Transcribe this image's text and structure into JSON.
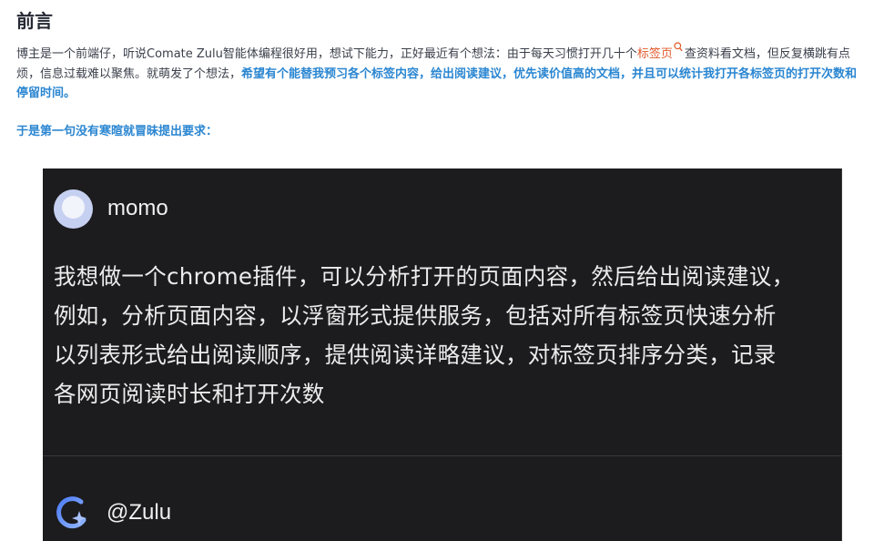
{
  "header": {
    "title": "前言"
  },
  "intro": {
    "part1": "博主是一个前端仔，听说Comate Zulu智能体编程很好用，想试下能力，正好最近有个想法：由于每天习惯打开几十个",
    "tag_link": "标签页",
    "part2": "查资料看文档，但反复横跳有点烦，信息过载难以聚焦。就萌发了个想法，",
    "highlight": "希望有个能替我预习各个标签内容，给出阅读建议，优先读价值高的文档，并且可以统计我打开各标签页的打开次数和停留时间。"
  },
  "lead_text": "于是第一句没有寒暄就冒昧提出要求：",
  "chat": {
    "user_name": "momo",
    "message_lines": [
      "我想做一个chrome插件，可以分析打开的页面内容，然后给出阅读建议，",
      "例如，分析页面内容，以浮窗形式提供服务，包括对所有标签页快速分析",
      "以列表形式给出阅读顺序，提供阅读详略建议，对标签页排序分类，记录",
      "各网页阅读时长和打开次数"
    ],
    "bot_name": "@Zulu"
  },
  "icons": {
    "search": "search-icon",
    "avatar": "user-avatar",
    "bot": "zulu-logo-icon"
  },
  "colors": {
    "link": "#e0592a",
    "highlight": "#2a86d1",
    "chat_bg": "#1c1c1e"
  }
}
